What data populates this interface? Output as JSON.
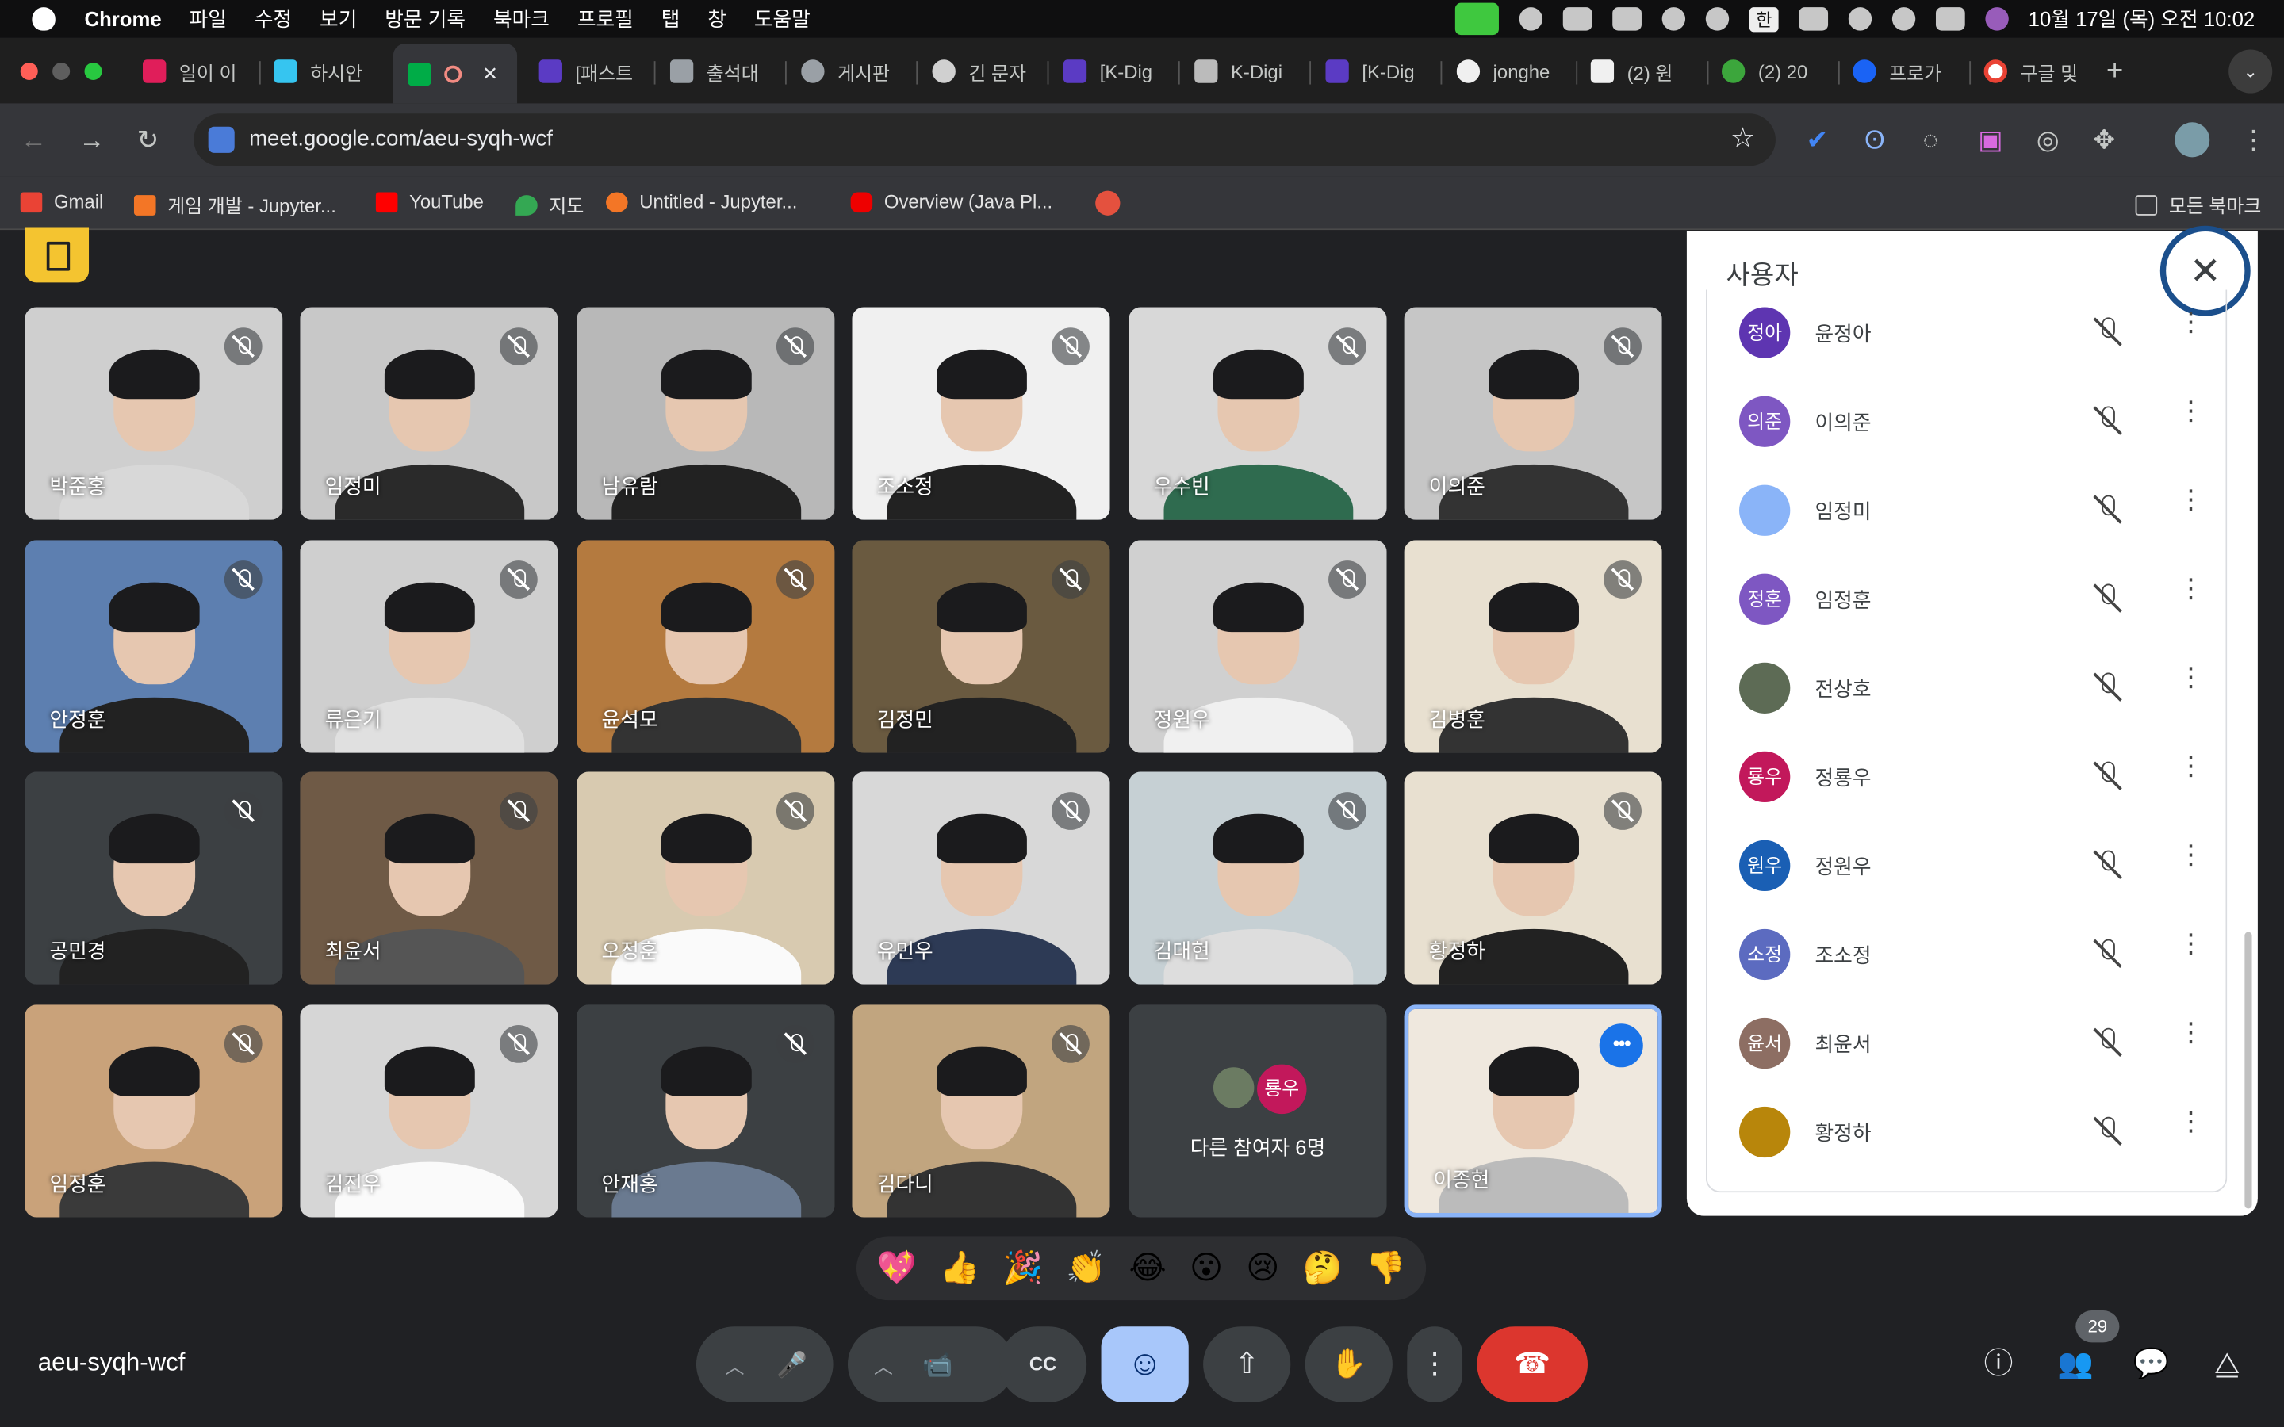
{
  "menubar": {
    "app": "Chrome",
    "items": [
      "파일",
      "수정",
      "보기",
      "방문 기록",
      "북마크",
      "프로필",
      "탭",
      "창",
      "도움말"
    ],
    "ime": "한",
    "datetime": "10월 17일 (목) 오전 10:02"
  },
  "tabs": [
    "일이 이",
    "하시안",
    "",
    "[패스트",
    "출석대",
    "게시판",
    "긴 문자",
    "[K-Dig",
    "K-Digi",
    "[K-Dig",
    "jonghe",
    "(2) 원",
    "(2) 20",
    "프로가",
    "구글 및"
  ],
  "browser": {
    "url": "meet.google.com/aeu-syqh-wcf",
    "new_tab": "+"
  },
  "bookmarks": [
    "Gmail",
    "게임 개발 - Jupyter...",
    "YouTube",
    "지도",
    "Untitled - Jupyter...",
    "Overview (Java Pl..."
  ],
  "bookmarks_all": "모든 북마크",
  "tiles": [
    "박준홍",
    "임정미",
    "남유람",
    "조소정",
    "우수빈",
    "이의준",
    "안정훈",
    "류은기",
    "윤석모",
    "김정민",
    "정원우",
    "김병훈",
    "공민경",
    "최윤서",
    "오정훈",
    "유민우",
    "김대현",
    "황정하",
    "임정훈",
    "김진우",
    "안재홍",
    "김다니",
    "이종현"
  ],
  "others": {
    "avatar": "룡우",
    "text": "다른 참여자 6명"
  },
  "panel": {
    "title": "사용자",
    "close": "✕",
    "people": [
      {
        "initials": "정아",
        "name": "윤정아",
        "color": "#5e35b1"
      },
      {
        "initials": "의준",
        "name": "이의준",
        "color": "#7e57c2"
      },
      {
        "initials": "",
        "name": "임정미",
        "color": "#8ab4f8"
      },
      {
        "initials": "정훈",
        "name": "임정훈",
        "color": "#7e57c2"
      },
      {
        "initials": "",
        "name": "전상호",
        "color": "#5d6b55"
      },
      {
        "initials": "룡우",
        "name": "정룡우",
        "color": "#c2185b"
      },
      {
        "initials": "원우",
        "name": "정원우",
        "color": "#1a5fb4"
      },
      {
        "initials": "소정",
        "name": "조소정",
        "color": "#5c6bc0"
      },
      {
        "initials": "윤서",
        "name": "최윤서",
        "color": "#8d6e63"
      },
      {
        "initials": "",
        "name": "황정하",
        "color": "#b8860b"
      }
    ]
  },
  "reactions": [
    "💖",
    "👍",
    "🎉",
    "👏",
    "😂",
    "😮",
    "😢",
    "🤔",
    "👎"
  ],
  "meeting_code": "aeu-syqh-wcf",
  "participant_count": "29",
  "controls": {
    "mic": "🎤",
    "camera": "📹",
    "captions": "CC",
    "emoji": "☺",
    "present": "⇧",
    "hand": "✋",
    "more": "⋮",
    "end": "☎"
  }
}
